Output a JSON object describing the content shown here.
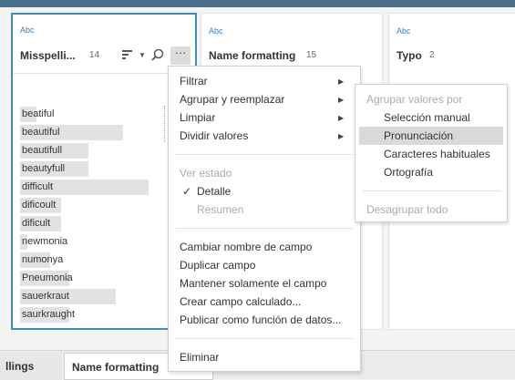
{
  "columns": [
    {
      "type": "Abc",
      "title": "Misspelli...",
      "count": "14"
    },
    {
      "type": "Abc",
      "title": "Name formatting",
      "count": "15"
    },
    {
      "type": "Abc",
      "title": "Typo",
      "count": "2"
    }
  ],
  "values": [
    "beatiful",
    "beautiful",
    "beautifull",
    "beautyfull",
    "difficult",
    "dificoult",
    "dificult",
    "newmonia",
    "numonya",
    "Pneumonia",
    "sauerkraut",
    "saurkraught"
  ],
  "value_bars": [
    0.12,
    0.75,
    0.5,
    0.5,
    0.94,
    0.3,
    0.3,
    0.05,
    0.22,
    0.36,
    0.7,
    0.36
  ],
  "icons": {
    "sort": "sort-icon",
    "chevron": "chevron-down-icon",
    "search": "search-icon",
    "more": "more-icon"
  },
  "more_glyph": "···",
  "context_menu": {
    "group1": [
      "Filtrar",
      "Agrupar y reemplazar",
      "Limpiar",
      "Dividir valores"
    ],
    "view_header": "Ver estado",
    "detail": "Detalle",
    "summary": "Resumen",
    "group3": [
      "Cambiar nombre de campo",
      "Duplicar campo",
      "Mantener solamente el campo",
      "Crear campo calculado...",
      "Publicar como función de datos..."
    ],
    "delete": "Eliminar"
  },
  "submenu": {
    "header": "Agrupar valores por",
    "items": [
      "Selección manual",
      "Pronunciación",
      "Caracteres habituales",
      "Ortografía"
    ],
    "ungroup": "Desagrupar todo"
  },
  "bottom_tabs": [
    "llings",
    "Name formatting"
  ],
  "colors": {
    "accent": "#3b8fc4",
    "highlight": "#d9d9d9",
    "topbar": "#4a6f8a"
  }
}
